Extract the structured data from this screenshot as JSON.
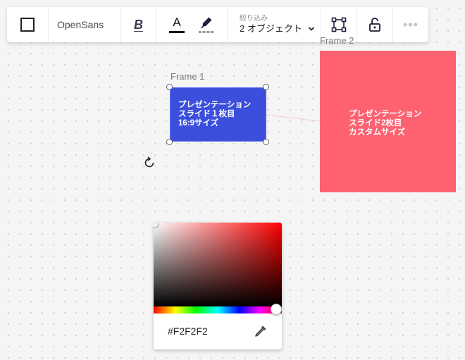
{
  "toolbar": {
    "font_name": "OpenSans",
    "bold_label": "B",
    "text_color_glyph": "A",
    "text_color": "#000000",
    "highlight_color": "#aaaaaa",
    "filter": {
      "label": "絞り込み",
      "value": "2 オブジェクト"
    },
    "more_label": "•••",
    "icons": {
      "shape": "square-outline-icon",
      "pen": "marker-pen-icon",
      "chevron": "chevron-down-icon",
      "frame": "frame-icon",
      "lock": "unlock-icon",
      "more": "more-dots-icon"
    }
  },
  "canvas": {
    "frame1": {
      "label": "Frame 1",
      "lines": [
        "プレゼンテーション",
        "スライド１枚目",
        "16:9サイズ"
      ],
      "color": "#3b4fdc"
    },
    "frame2": {
      "label": "Frame 2",
      "lines": [
        "プレゼンテーション",
        "スライド2枚目",
        "カスタムサイズ"
      ],
      "color": "#fe6271"
    },
    "rotate_icon": "rotate-icon"
  },
  "color_picker": {
    "hex": "#F2F2F2",
    "hue_color": "#ff0000",
    "selected_color": "#f2f2f2",
    "eyedropper_icon": "eyedropper-icon"
  }
}
